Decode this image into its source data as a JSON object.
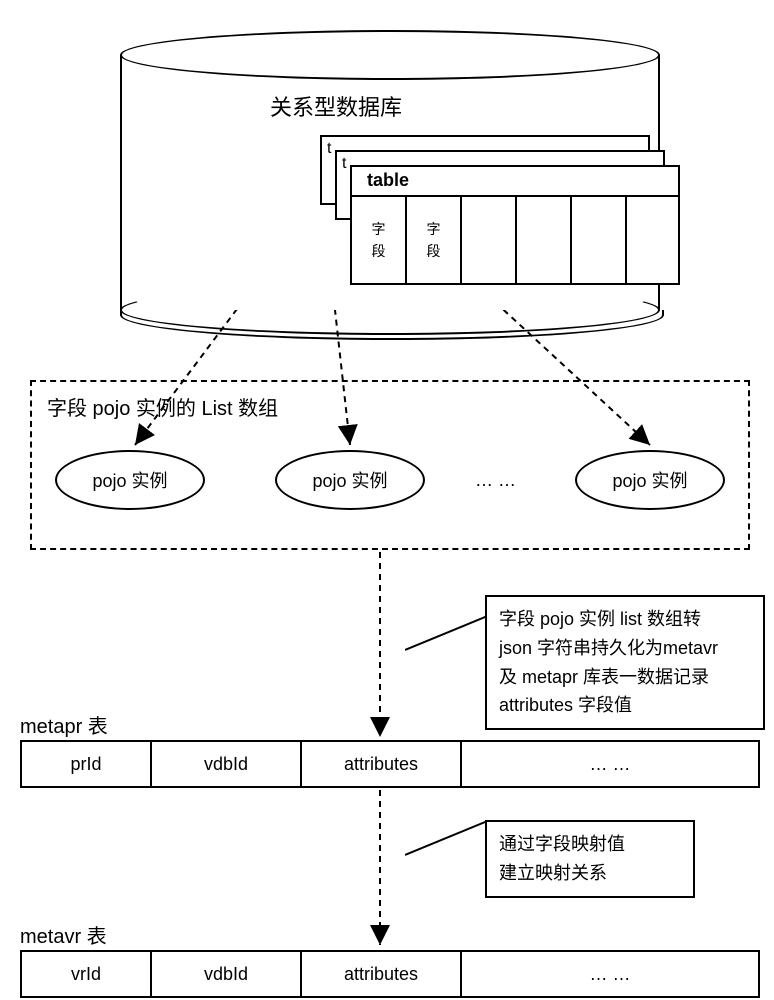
{
  "db": {
    "title": "关系型数据库"
  },
  "tables": {
    "t3_label": "t",
    "t2_label": "t",
    "t1_main": "table",
    "field_text": "字段"
  },
  "pojo_box": {
    "title": "字段 pojo 实例的 List 数组",
    "items": [
      "pojo 实例",
      "pojo 实例",
      "pojo 实例"
    ],
    "dots": "… …"
  },
  "metapr": {
    "label": "metapr 表",
    "cols": [
      "prId",
      "vdbId",
      "attributes",
      "… …"
    ]
  },
  "metavr": {
    "label": "metavr 表",
    "cols": [
      "vrId",
      "vdbId",
      "attributes",
      "… …"
    ]
  },
  "ann1": {
    "line1": "字段 pojo 实例 list 数组转",
    "line2": "json 字符串持久化为metavr",
    "line3": "及 metapr 库表一数据记录",
    "line4": "attributes 字段值"
  },
  "ann2": {
    "line1": "通过字段映射值",
    "line2": "建立映射关系"
  }
}
